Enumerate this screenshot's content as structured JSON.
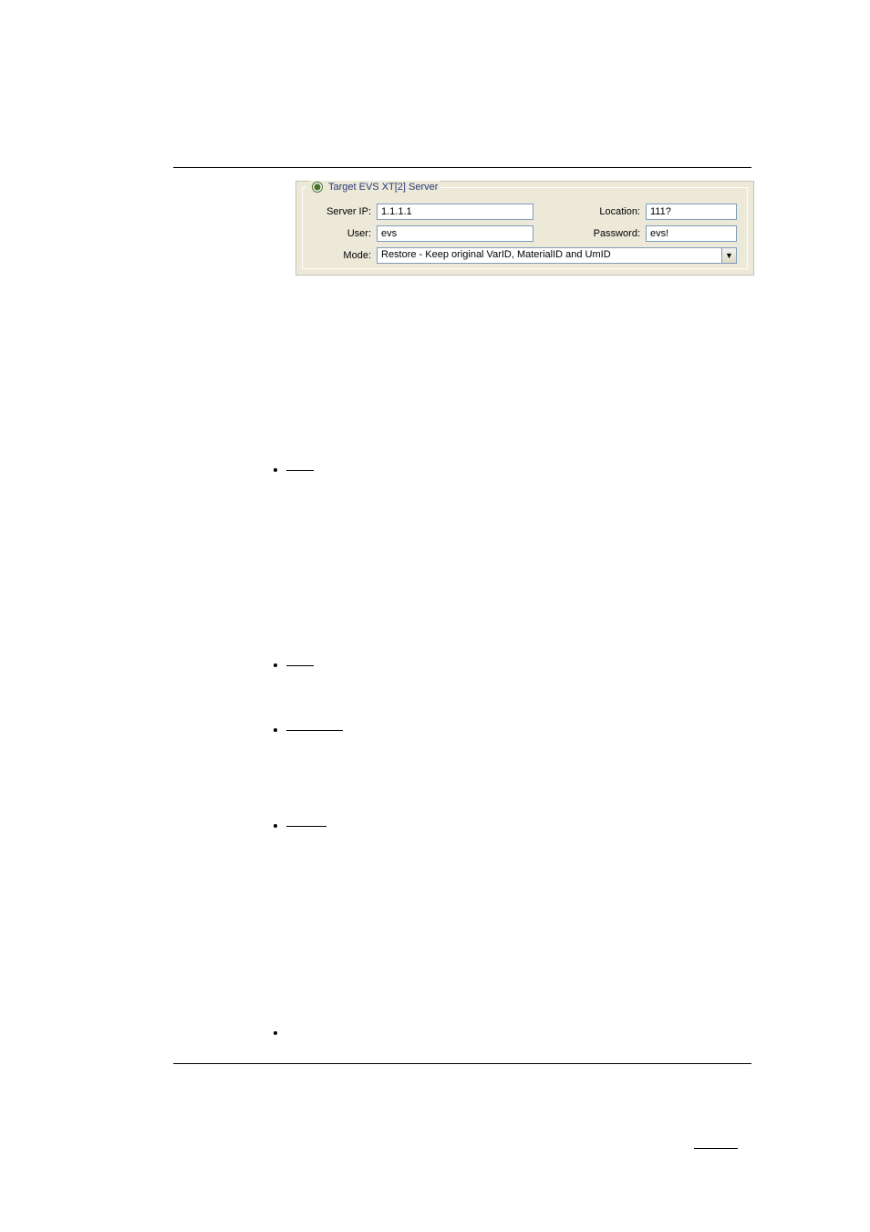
{
  "panel": {
    "legend": "Target EVS XT[2] Server",
    "labels": {
      "server_ip": "Server IP:",
      "location": "Location:",
      "user": "User:",
      "password": "Password:",
      "mode": "Mode:"
    },
    "values": {
      "server_ip": "1.1.1.1",
      "location": "111?",
      "user": "evs",
      "password": "evs!",
      "mode_selected": "Restore - Keep original VarID, MaterialID and UmID"
    },
    "radio_selected": true
  }
}
